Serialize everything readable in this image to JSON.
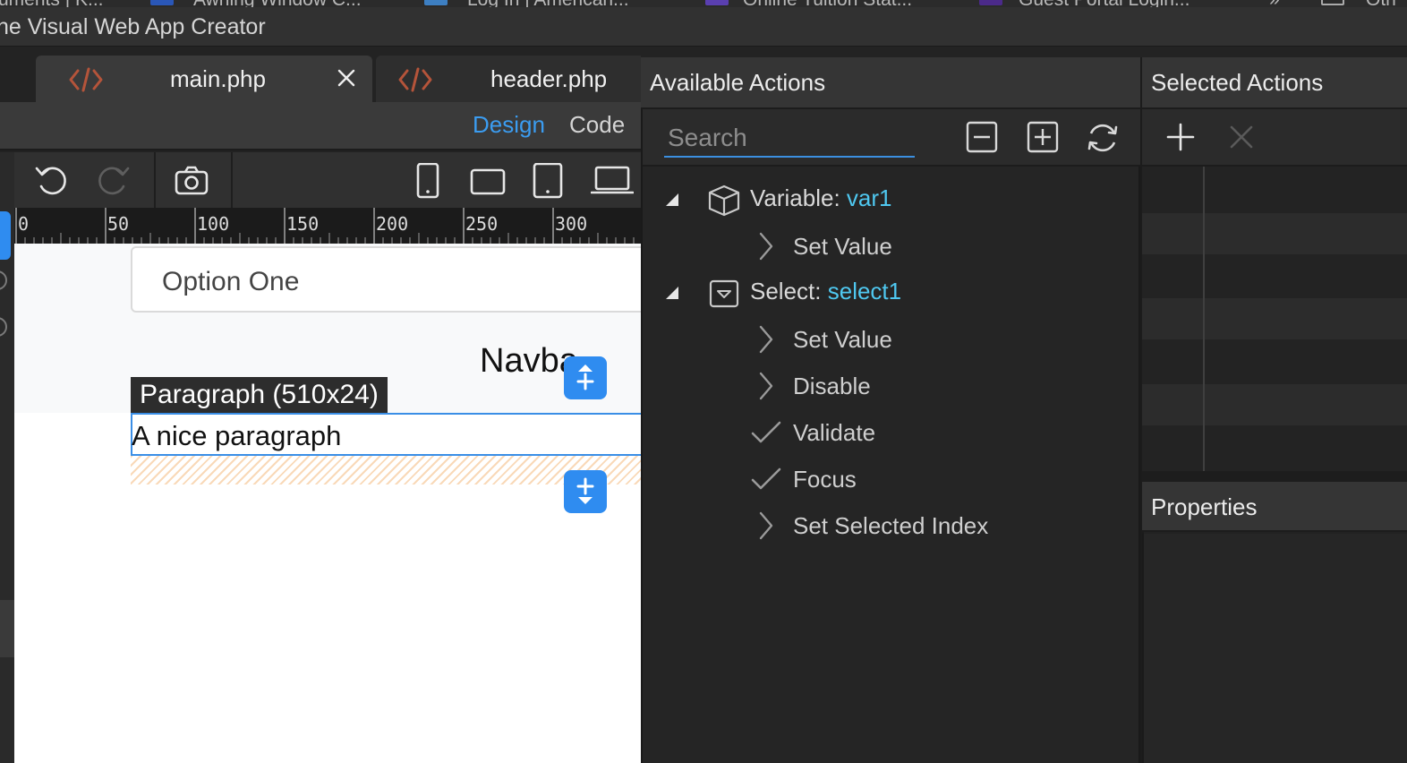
{
  "browser": {
    "bookmarks": [
      "uments | K...",
      "Awning Window C...",
      "Log In | American...",
      "Online Tuition Stat...",
      "Guest Portal Login...",
      "»",
      "Oth"
    ]
  },
  "window": {
    "title": "he Visual Web App Creator"
  },
  "editor": {
    "tabs": [
      {
        "label": "main.php",
        "icon": "code-icon",
        "closable": true
      },
      {
        "label": "header.php",
        "icon": "code-icon"
      }
    ],
    "view_modes": {
      "design": "Design",
      "code": "Code",
      "active": "Design"
    },
    "toolbar_icons": [
      "undo-icon",
      "redo-icon",
      "camera-icon",
      "phone-icon",
      "tablet-landscape-icon",
      "tablet-portrait-icon",
      "laptop-icon"
    ],
    "ruler_ticks": [
      "0",
      "50",
      "100",
      "150",
      "200",
      "250",
      "300"
    ]
  },
  "canvas": {
    "select_option": "Option One",
    "navbar_text": "Navba",
    "selection_label": "Paragraph (510x24)",
    "paragraph_text": "A nice paragraph"
  },
  "available_actions": {
    "title": "Available Actions",
    "search_placeholder": "Search",
    "tools": [
      "collapse-all-icon",
      "expand-all-icon",
      "refresh-icon"
    ],
    "groups": [
      {
        "kind": "Variable:",
        "name": "var1",
        "icon": "cube-icon",
        "actions": [
          {
            "label": "Set Value",
            "icon": "chevron-right-icon"
          }
        ]
      },
      {
        "kind": "Select:",
        "name": "select1",
        "icon": "select-dropdown-icon",
        "actions": [
          {
            "label": "Set Value",
            "icon": "chevron-right-icon"
          },
          {
            "label": "Disable",
            "icon": "chevron-right-icon"
          },
          {
            "label": "Validate",
            "icon": "check-icon"
          },
          {
            "label": "Focus",
            "icon": "check-icon"
          },
          {
            "label": "Set Selected Index",
            "icon": "chevron-right-icon"
          }
        ]
      }
    ]
  },
  "selected_actions": {
    "title": "Selected Actions",
    "tools": [
      "plus-icon",
      "close-icon"
    ]
  },
  "properties": {
    "title": "Properties"
  },
  "colors": {
    "accent": "#3b9cf0",
    "link_name": "#4fc8f0",
    "brand_code_icon": "#b5543a"
  }
}
